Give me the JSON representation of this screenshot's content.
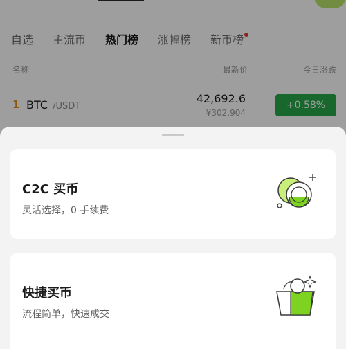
{
  "top": {
    "title_bar_color": "#2a2a2a",
    "pill_color": "#b8e36a"
  },
  "tabs": [
    {
      "label": "自选"
    },
    {
      "label": "主流币"
    },
    {
      "label": "热门榜"
    },
    {
      "label": "涨幅榜"
    },
    {
      "label": "新币榜"
    }
  ],
  "columns": {
    "name": "名称",
    "price": "最新价",
    "change": "今日涨跌"
  },
  "row": {
    "rank": "1",
    "symbol": "BTC",
    "quote": "/USDT",
    "price": "42,692.6",
    "price_cny": "¥302,904",
    "change": "+0.58%"
  },
  "sheet": {
    "c2c": {
      "title": "C2C 买币",
      "subtitle": "灵活选择，0 手续费",
      "icon": "coins-icon"
    },
    "quick": {
      "title": "快捷买币",
      "subtitle": "流程简单，快速成交",
      "icon": "wallet-icon"
    }
  },
  "colors": {
    "accent_green": "#27a84a",
    "lime": "#b8e36a",
    "rank_orange": "#e58a16"
  }
}
